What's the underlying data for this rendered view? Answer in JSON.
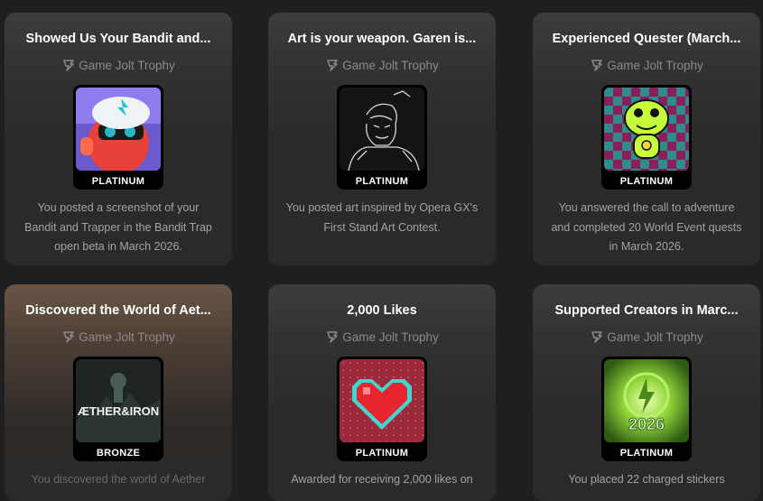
{
  "trophies": [
    {
      "title": "Showed Us Your Bandit and...",
      "source": "Game Jolt Trophy",
      "tier": "PLATINUM",
      "description": "You posted a screenshot of your Bandit and Trapper in the Bandit Trap open beta in March 2026.",
      "art": "bandit-character-icon"
    },
    {
      "title": "Art is your weapon. Garen is...",
      "source": "Game Jolt Trophy",
      "tier": "PLATINUM",
      "description": "You posted art inspired by Opera GX's First Stand Art Contest.",
      "art": "garen-sketch-icon"
    },
    {
      "title": "Experienced Quester (March...",
      "source": "Game Jolt Trophy",
      "tier": "PLATINUM",
      "description": "You answered the call to adventure and completed 20 World Event quests in March 2026.",
      "art": "frog-character-icon"
    },
    {
      "title": "Discovered the World of Aet...",
      "source": "Game Jolt Trophy",
      "tier": "BRONZE",
      "description": "You discovered the world of Aether",
      "art": "aether-iron-logo",
      "art_text": "ÆTHER&IRON"
    },
    {
      "title": "2,000 Likes",
      "source": "Game Jolt Trophy",
      "tier": "PLATINUM",
      "description": "Awarded for receiving 2,000 likes on",
      "art": "pixel-heart-icon"
    },
    {
      "title": "Supported Creators in Marc...",
      "source": "Game Jolt Trophy",
      "tier": "PLATINUM",
      "description": "You placed 22 charged stickers",
      "art": "charged-2026-icon",
      "art_text": "2026"
    }
  ],
  "colors": {
    "background": "#1f1f1f",
    "card": "#2a2a2a",
    "muted_text": "#a3a3a3"
  }
}
